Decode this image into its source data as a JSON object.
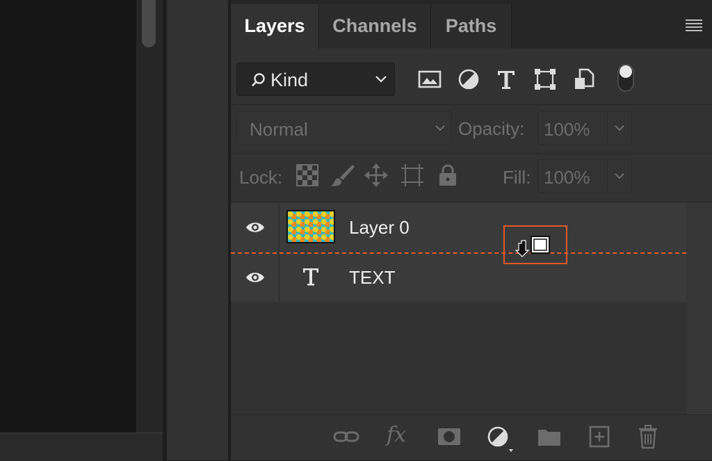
{
  "panel": {
    "tabs": [
      {
        "label": "Layers",
        "active": true
      },
      {
        "label": "Channels",
        "active": false
      },
      {
        "label": "Paths",
        "active": false
      }
    ],
    "menu_icon": "hamburger-menu-icon"
  },
  "filter": {
    "kind_label": "Kind",
    "icons": [
      "image-filter-icon",
      "adjustment-filter-icon",
      "type-filter-icon",
      "shape-filter-icon",
      "smart-object-filter-icon",
      "filter-toggle-icon"
    ]
  },
  "blend": {
    "mode": "Normal",
    "opacity_label": "Opacity:",
    "opacity_value": "100%"
  },
  "lock": {
    "label": "Lock:",
    "icons": [
      "lock-transparent-pixels-icon",
      "lock-image-pixels-icon",
      "lock-position-icon",
      "lock-artboard-icon",
      "lock-all-icon"
    ],
    "fill_label": "Fill:",
    "fill_value": "100%"
  },
  "layers": [
    {
      "name": "Layer 0",
      "kind": "image",
      "visible": true
    },
    {
      "name": "TEXT",
      "kind": "type",
      "visible": true
    }
  ],
  "footer": {
    "icons": [
      "link-layers-icon",
      "fx-icon",
      "layer-mask-icon",
      "adjustment-layer-icon",
      "group-folder-icon",
      "new-layer-icon",
      "trash-icon"
    ],
    "fx_label": "fx"
  },
  "colors": {
    "highlight": "#e0582b",
    "panel": "#323232",
    "list": "#3a3a3a"
  }
}
